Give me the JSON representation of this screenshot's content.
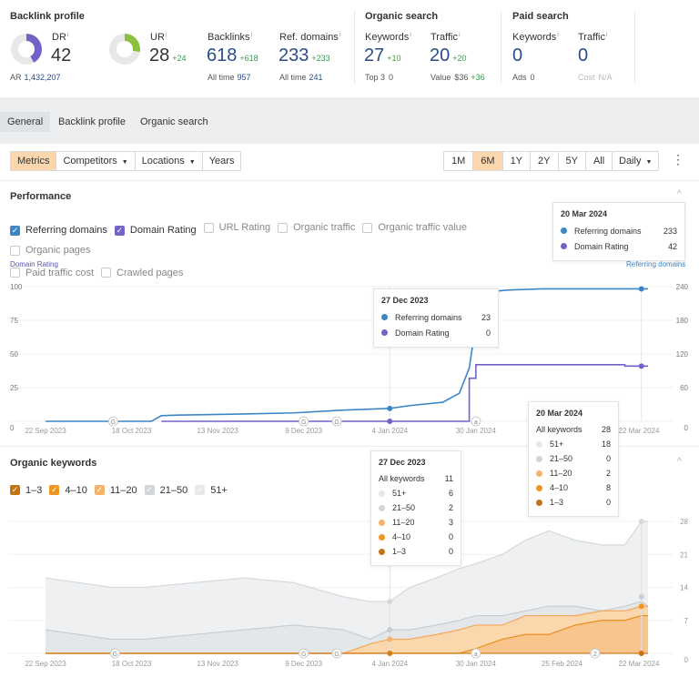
{
  "header": {
    "backlink_profile": {
      "title": "Backlink profile",
      "dr": {
        "label": "DR",
        "info": "i",
        "value": "42",
        "fraction": 0.42,
        "color": "#7461c8"
      },
      "ar": {
        "label": "AR",
        "value": "1,432,207"
      },
      "ur": {
        "label": "UR",
        "info": "i",
        "value": "28",
        "delta": "+24",
        "fraction": 0.28,
        "color": "#8cbf3f"
      },
      "backlinks": {
        "label": "Backlinks",
        "info": "i",
        "value": "618",
        "delta": "+618",
        "sub_label": "All time",
        "sub_value": "957"
      },
      "ref_domains": {
        "label": "Ref. domains",
        "info": "i",
        "value": "233",
        "delta": "+233",
        "sub_label": "All time",
        "sub_value": "241"
      }
    },
    "organic_search": {
      "title": "Organic search",
      "keywords": {
        "label": "Keywords",
        "info": "i",
        "value": "27",
        "delta": "+10",
        "sub_label": "Top 3",
        "sub_value": "0"
      },
      "traffic": {
        "label": "Traffic",
        "info": "i",
        "value": "20",
        "delta": "+20",
        "sub_label": "Value",
        "sub_value": "$36",
        "sub_delta": "+36"
      }
    },
    "paid_search": {
      "title": "Paid search",
      "keywords": {
        "label": "Keywords",
        "info": "i",
        "value": "0",
        "sub_label": "Ads",
        "sub_value": "0"
      },
      "traffic": {
        "label": "Traffic",
        "info": "i",
        "value": "0",
        "sub_label": "Cost",
        "sub_value": "N/A"
      }
    }
  },
  "tabs": [
    {
      "label": "General",
      "active": true
    },
    {
      "label": "Backlink profile",
      "active": false
    },
    {
      "label": "Organic search",
      "active": false
    }
  ],
  "toolbar": {
    "left": [
      {
        "label": "Metrics",
        "selected": true,
        "dropdown": false
      },
      {
        "label": "Competitors",
        "selected": false,
        "dropdown": true
      },
      {
        "label": "Locations",
        "selected": false,
        "dropdown": true
      },
      {
        "label": "Years",
        "selected": false,
        "dropdown": false
      }
    ],
    "ranges": [
      {
        "label": "1M",
        "selected": false
      },
      {
        "label": "6M",
        "selected": true
      },
      {
        "label": "1Y",
        "selected": false
      },
      {
        "label": "2Y",
        "selected": false
      },
      {
        "label": "5Y",
        "selected": false
      },
      {
        "label": "All",
        "selected": false
      }
    ],
    "interval": "Daily",
    "caret": "▼",
    "more": "⋮"
  },
  "performance": {
    "title": "Performance",
    "collapse": "^",
    "checkboxes": [
      {
        "label": "Referring domains",
        "checked": true,
        "color": "#3c86c6"
      },
      {
        "label": "Domain Rating",
        "checked": true,
        "color": "#7461c8"
      },
      {
        "label": "URL Rating",
        "checked": false
      },
      {
        "label": "Organic traffic",
        "checked": false
      },
      {
        "label": "Organic traffic value",
        "checked": false
      },
      {
        "label": "Organic pages",
        "checked": false
      },
      {
        "label": "Paid traffic cost",
        "checked": false
      },
      {
        "label": "Crawled pages",
        "checked": false
      }
    ],
    "tooltip_hover": {
      "date": "27 Dec 2023",
      "rows": [
        {
          "label": "Referring domains",
          "value": "23",
          "color": "#3c86c6"
        },
        {
          "label": "Domain Rating",
          "value": "0",
          "color": "#7461c8"
        }
      ]
    },
    "tooltip_end": {
      "date": "20 Mar 2024",
      "rows": [
        {
          "label": "Referring domains",
          "value": "233",
          "color": "#3c86c6"
        },
        {
          "label": "Domain Rating",
          "value": "42",
          "color": "#7461c8"
        }
      ]
    }
  },
  "organic_keywords": {
    "title": "Organic keywords",
    "collapse": "^",
    "checkboxes": [
      {
        "label": "1–3",
        "checked": true,
        "color": "#c47414"
      },
      {
        "label": "4–10",
        "checked": true,
        "color": "#ee9522"
      },
      {
        "label": "11–20",
        "checked": true,
        "color": "#f5b36a"
      },
      {
        "label": "21–50",
        "checked": true,
        "color": "#d3d6d8"
      },
      {
        "label": "51+",
        "checked": true,
        "color": "#e6e8ea"
      }
    ],
    "tooltip_hover": {
      "date": "27 Dec 2023",
      "total_label": "All keywords",
      "total": "11",
      "rows": [
        {
          "label": "51+",
          "value": "6",
          "color": "#e6e8ea"
        },
        {
          "label": "21–50",
          "value": "2",
          "color": "#d3d6d8"
        },
        {
          "label": "11–20",
          "value": "3",
          "color": "#f5b36a"
        },
        {
          "label": "4–10",
          "value": "0",
          "color": "#ee9522"
        },
        {
          "label": "1–3",
          "value": "0",
          "color": "#c47414"
        }
      ]
    },
    "tooltip_end": {
      "date": "20 Mar 2024",
      "total_label": "All keywords",
      "total": "28",
      "rows": [
        {
          "label": "51+",
          "value": "18",
          "color": "#e6e8ea"
        },
        {
          "label": "21–50",
          "value": "0",
          "color": "#d3d6d8"
        },
        {
          "label": "11–20",
          "value": "2",
          "color": "#f5b36a"
        },
        {
          "label": "4–10",
          "value": "8",
          "color": "#ee9522"
        },
        {
          "label": "1–3",
          "value": "0",
          "color": "#c47414"
        }
      ]
    }
  },
  "chart_data": [
    {
      "type": "line",
      "title": "Performance",
      "ylabel_left": "Domain Rating",
      "ylabel_right": "Referring domains",
      "ylim_left": [
        0,
        100
      ],
      "ylim_right": [
        0,
        240
      ],
      "yticks_left": [
        "0",
        "25",
        "50",
        "75",
        "100"
      ],
      "yticks_right": [
        "0",
        "60",
        "120",
        "180",
        "240"
      ],
      "xticks": [
        "22 Sep 2023",
        "18 Oct 2023",
        "13 Nov 2023",
        "9 Dec 2023",
        "4 Jan 2024",
        "30 Jan 2024",
        "22 Mar 2024"
      ],
      "x_days": [
        0,
        14,
        32,
        35,
        40,
        60,
        75,
        90,
        104,
        110,
        120,
        125,
        128,
        130,
        133,
        136,
        140,
        150,
        175,
        182
      ],
      "series": [
        {
          "name": "Referring domains",
          "axis": "right",
          "color": "#3c86c6",
          "values": [
            0,
            0,
            0,
            10,
            11,
            13,
            15,
            20,
            23,
            28,
            34,
            50,
            95,
            175,
            210,
            232,
            234,
            236,
            236,
            236
          ]
        },
        {
          "name": "Domain Rating",
          "axis": "left",
          "color": "#7461c8",
          "values": [
            null,
            null,
            null,
            0,
            0,
            0,
            0,
            0,
            0,
            0,
            0,
            0,
            32,
            42,
            42,
            42,
            42,
            42,
            41,
            41
          ]
        }
      ],
      "annotations": [
        "G",
        "G",
        "G",
        "G",
        "a"
      ],
      "grid": true
    },
    {
      "type": "area",
      "title": "Organic keywords",
      "ylim": [
        0,
        28
      ],
      "yticks": [
        "0",
        "7",
        "14",
        "21",
        "28"
      ],
      "xticks": [
        "22 Sep 2023",
        "18 Oct 2023",
        "13 Nov 2023",
        "9 Dec 2023",
        "4 Jan 2024",
        "30 Jan 2024",
        "25 Feb 2024",
        "22 Mar 2024"
      ],
      "x_days": [
        0,
        10,
        20,
        30,
        45,
        60,
        75,
        90,
        98,
        104,
        110,
        118,
        125,
        130,
        138,
        145,
        152,
        160,
        168,
        175,
        180,
        182
      ],
      "stacked_cumulative": [
        {
          "name": "1–3",
          "color": "#c47414",
          "values": [
            0,
            0,
            0,
            0,
            0,
            0,
            0,
            0,
            0,
            0,
            0,
            0,
            0,
            0,
            0,
            0,
            0,
            0,
            0,
            0,
            0,
            0
          ]
        },
        {
          "name": "4–10",
          "color": "#ee9522",
          "values": [
            0,
            0,
            0,
            0,
            0,
            0,
            0,
            0,
            0,
            0,
            0,
            0,
            0,
            1,
            3,
            4,
            4,
            6,
            7,
            7,
            8,
            8
          ]
        },
        {
          "name": "11–20",
          "color": "#f5b36a",
          "values": [
            0,
            0,
            0,
            0,
            0,
            0,
            0,
            0,
            2,
            3,
            3,
            4,
            5,
            6,
            6,
            8,
            8,
            8,
            9,
            9,
            10,
            10
          ]
        },
        {
          "name": "21–50",
          "color": "#d3d6d8",
          "values": [
            5,
            4,
            3,
            3,
            4,
            5,
            6,
            5,
            3,
            5,
            5,
            6,
            7,
            8,
            8,
            9,
            10,
            10,
            9,
            10,
            11,
            10
          ]
        },
        {
          "name": "51+",
          "color": "#e6e8ea",
          "values": [
            16,
            15,
            14,
            14,
            15,
            16,
            15,
            12,
            11,
            11,
            14,
            16,
            18,
            19,
            21,
            24,
            26,
            24,
            23,
            23,
            28,
            28
          ]
        }
      ],
      "annotations": [
        "G",
        "G",
        "G",
        "G",
        "a",
        "2"
      ],
      "grid": true
    }
  ]
}
